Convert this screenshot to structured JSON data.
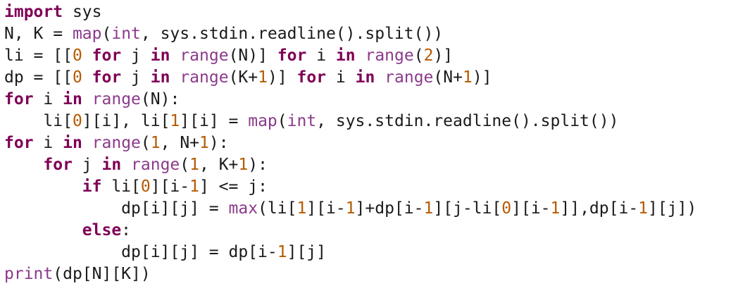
{
  "editor": {
    "lines": [
      [
        {
          "t": "kw",
          "v": "import"
        },
        {
          "t": "plain",
          "v": " sys"
        }
      ],
      [
        {
          "t": "plain",
          "v": "N, K = "
        },
        {
          "t": "builtin",
          "v": "map"
        },
        {
          "t": "plain",
          "v": "("
        },
        {
          "t": "builtin",
          "v": "int"
        },
        {
          "t": "plain",
          "v": ", sys.stdin.readline().split())"
        }
      ],
      [
        {
          "t": "plain",
          "v": "li = [["
        },
        {
          "t": "num",
          "v": "0"
        },
        {
          "t": "plain",
          "v": " "
        },
        {
          "t": "kw",
          "v": "for"
        },
        {
          "t": "plain",
          "v": " j "
        },
        {
          "t": "kw",
          "v": "in"
        },
        {
          "t": "plain",
          "v": " "
        },
        {
          "t": "builtin",
          "v": "range"
        },
        {
          "t": "plain",
          "v": "(N)] "
        },
        {
          "t": "kw",
          "v": "for"
        },
        {
          "t": "plain",
          "v": " i "
        },
        {
          "t": "kw",
          "v": "in"
        },
        {
          "t": "plain",
          "v": " "
        },
        {
          "t": "builtin",
          "v": "range"
        },
        {
          "t": "plain",
          "v": "("
        },
        {
          "t": "num",
          "v": "2"
        },
        {
          "t": "plain",
          "v": ")]"
        }
      ],
      [
        {
          "t": "plain",
          "v": "dp = [["
        },
        {
          "t": "num",
          "v": "0"
        },
        {
          "t": "plain",
          "v": " "
        },
        {
          "t": "kw",
          "v": "for"
        },
        {
          "t": "plain",
          "v": " j "
        },
        {
          "t": "kw",
          "v": "in"
        },
        {
          "t": "plain",
          "v": " "
        },
        {
          "t": "builtin",
          "v": "range"
        },
        {
          "t": "plain",
          "v": "(K+"
        },
        {
          "t": "num",
          "v": "1"
        },
        {
          "t": "plain",
          "v": ")] "
        },
        {
          "t": "kw",
          "v": "for"
        },
        {
          "t": "plain",
          "v": " i "
        },
        {
          "t": "kw",
          "v": "in"
        },
        {
          "t": "plain",
          "v": " "
        },
        {
          "t": "builtin",
          "v": "range"
        },
        {
          "t": "plain",
          "v": "(N+"
        },
        {
          "t": "num",
          "v": "1"
        },
        {
          "t": "plain",
          "v": ")]"
        }
      ],
      [
        {
          "t": "kw",
          "v": "for"
        },
        {
          "t": "plain",
          "v": " i "
        },
        {
          "t": "kw",
          "v": "in"
        },
        {
          "t": "plain",
          "v": " "
        },
        {
          "t": "builtin",
          "v": "range"
        },
        {
          "t": "plain",
          "v": "(N):"
        }
      ],
      [
        {
          "t": "plain",
          "v": "    li["
        },
        {
          "t": "num",
          "v": "0"
        },
        {
          "t": "plain",
          "v": "][i], li["
        },
        {
          "t": "num",
          "v": "1"
        },
        {
          "t": "plain",
          "v": "][i] = "
        },
        {
          "t": "builtin",
          "v": "map"
        },
        {
          "t": "plain",
          "v": "("
        },
        {
          "t": "builtin",
          "v": "int"
        },
        {
          "t": "plain",
          "v": ", sys.stdin.readline().split())"
        }
      ],
      [
        {
          "t": "kw",
          "v": "for"
        },
        {
          "t": "plain",
          "v": " i "
        },
        {
          "t": "kw",
          "v": "in"
        },
        {
          "t": "plain",
          "v": " "
        },
        {
          "t": "builtin",
          "v": "range"
        },
        {
          "t": "plain",
          "v": "("
        },
        {
          "t": "num",
          "v": "1"
        },
        {
          "t": "plain",
          "v": ", N+"
        },
        {
          "t": "num",
          "v": "1"
        },
        {
          "t": "plain",
          "v": "):"
        }
      ],
      [
        {
          "t": "plain",
          "v": "    "
        },
        {
          "t": "kw",
          "v": "for"
        },
        {
          "t": "plain",
          "v": " j "
        },
        {
          "t": "kw",
          "v": "in"
        },
        {
          "t": "plain",
          "v": " "
        },
        {
          "t": "builtin",
          "v": "range"
        },
        {
          "t": "plain",
          "v": "("
        },
        {
          "t": "num",
          "v": "1"
        },
        {
          "t": "plain",
          "v": ", K+"
        },
        {
          "t": "num",
          "v": "1"
        },
        {
          "t": "plain",
          "v": "):"
        }
      ],
      [
        {
          "t": "plain",
          "v": "        "
        },
        {
          "t": "kw",
          "v": "if"
        },
        {
          "t": "plain",
          "v": " li["
        },
        {
          "t": "num",
          "v": "0"
        },
        {
          "t": "plain",
          "v": "][i-"
        },
        {
          "t": "num",
          "v": "1"
        },
        {
          "t": "plain",
          "v": "] <= j:"
        }
      ],
      [
        {
          "t": "plain",
          "v": "            dp[i][j] = "
        },
        {
          "t": "builtin",
          "v": "max"
        },
        {
          "t": "plain",
          "v": "(li["
        },
        {
          "t": "num",
          "v": "1"
        },
        {
          "t": "plain",
          "v": "][i-"
        },
        {
          "t": "num",
          "v": "1"
        },
        {
          "t": "plain",
          "v": "]+dp[i-"
        },
        {
          "t": "num",
          "v": "1"
        },
        {
          "t": "plain",
          "v": "][j-li["
        },
        {
          "t": "num",
          "v": "0"
        },
        {
          "t": "plain",
          "v": "][i-"
        },
        {
          "t": "num",
          "v": "1"
        },
        {
          "t": "plain",
          "v": "]],dp[i-"
        },
        {
          "t": "num",
          "v": "1"
        },
        {
          "t": "plain",
          "v": "][j])"
        }
      ],
      [
        {
          "t": "plain",
          "v": "        "
        },
        {
          "t": "kw",
          "v": "else"
        },
        {
          "t": "plain",
          "v": ":"
        }
      ],
      [
        {
          "t": "plain",
          "v": "            dp[i][j] = dp[i-"
        },
        {
          "t": "num",
          "v": "1"
        },
        {
          "t": "plain",
          "v": "][j]"
        }
      ],
      [
        {
          "t": "builtin",
          "v": "print"
        },
        {
          "t": "plain",
          "v": "(dp[N][K])"
        }
      ]
    ]
  }
}
